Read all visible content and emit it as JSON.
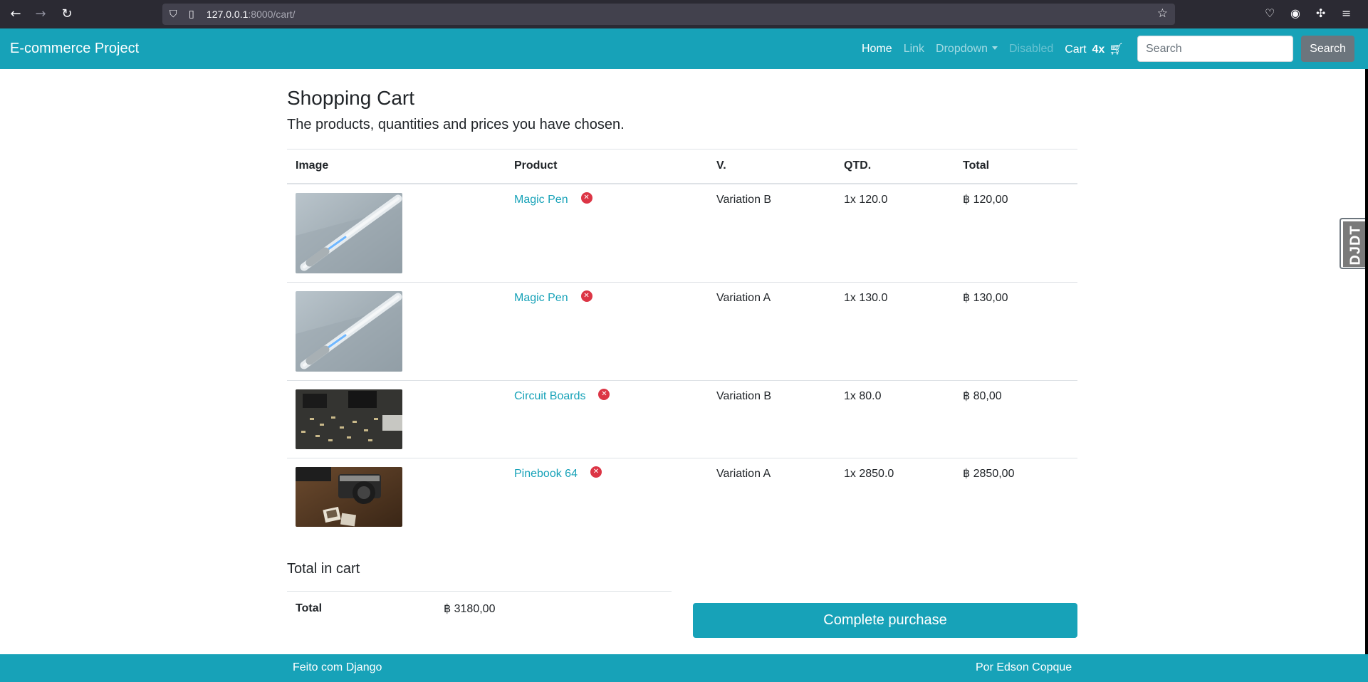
{
  "browser": {
    "url_host": "127.0.0.1",
    "url_rest": ":8000/cart/",
    "icons": [
      "back-arrow",
      "forward-arrow",
      "reload",
      "shield",
      "page",
      "star",
      "pocket",
      "account",
      "extensions",
      "menu"
    ]
  },
  "navbar": {
    "brand": "E-commerce Project",
    "home": "Home",
    "link": "Link",
    "dropdown": "Dropdown",
    "disabled": "Disabled",
    "cart_label": "Cart",
    "cart_count": "4x",
    "search_placeholder": "Search",
    "search_button": "Search"
  },
  "page": {
    "title": "Shopping Cart",
    "lead": "The products, quantities and prices you have chosen."
  },
  "table": {
    "headers": [
      "Image",
      "Product",
      "V.",
      "QTD.",
      "Total"
    ],
    "rows": [
      {
        "product": "Magic Pen",
        "variation": "Variation B",
        "qty": "1x 120.0",
        "total": "฿ 120,00",
        "image": "pen"
      },
      {
        "product": "Magic Pen",
        "variation": "Variation A",
        "qty": "1x 130.0",
        "total": "฿ 130,00",
        "image": "pen"
      },
      {
        "product": "Circuit Boards",
        "variation": "Variation B",
        "qty": "1x 80.0",
        "total": "฿ 80,00",
        "image": "circuit-board"
      },
      {
        "product": "Pinebook 64",
        "variation": "Variation A",
        "qty": "1x 2850.0",
        "total": "฿ 2850,00",
        "image": "camera"
      }
    ]
  },
  "summary": {
    "heading": "Total in cart",
    "label": "Total",
    "value": "฿ 3180,00",
    "button": "Complete purchase"
  },
  "footer": {
    "left": "Feito com Django",
    "right": "Por Edson Copque"
  },
  "debug_toolbar": {
    "label": "DJDT"
  },
  "colors": {
    "accent": "#17a2b8",
    "danger": "#dc3545",
    "secondary": "#6c757d"
  }
}
